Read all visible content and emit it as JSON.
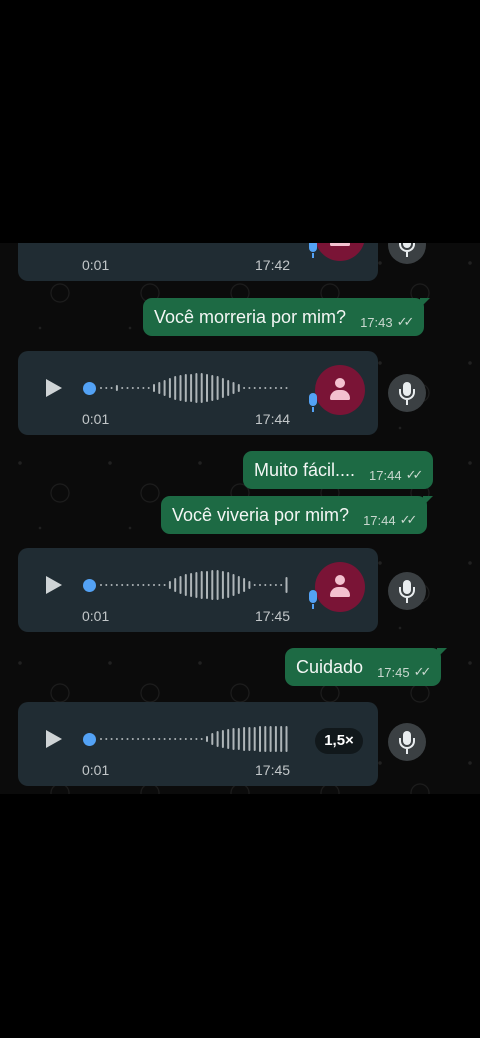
{
  "messages": [
    {
      "kind": "voice",
      "duration": "0:01",
      "time": "17:42",
      "badge": "avatar"
    },
    {
      "kind": "text",
      "text": "Você morreria por mim?",
      "time": "17:43",
      "status": "✓✓"
    },
    {
      "kind": "voice",
      "duration": "0:01",
      "time": "17:44",
      "badge": "avatar"
    },
    {
      "kind": "text",
      "text": "Muito fácil....",
      "time": "17:44",
      "status": "✓✓"
    },
    {
      "kind": "text",
      "text": "Você viveria por mim?",
      "time": "17:44",
      "status": "✓✓"
    },
    {
      "kind": "voice",
      "duration": "0:01",
      "time": "17:45",
      "badge": "avatar"
    },
    {
      "kind": "text",
      "text": "Cuidado",
      "time": "17:45",
      "status": "✓✓"
    },
    {
      "kind": "voice",
      "duration": "0:01",
      "time": "17:45",
      "badge": "speed",
      "speed": "1,5×"
    }
  ],
  "icons": {
    "play": "play-icon",
    "mic": "microphone-icon",
    "avatar": "person-icon"
  },
  "colors": {
    "outgoing_bubble": "#1d6a44",
    "incoming_bubble": "#202c33",
    "progress_dot": "#53a2f5",
    "avatar_bg": "#7a1436"
  }
}
